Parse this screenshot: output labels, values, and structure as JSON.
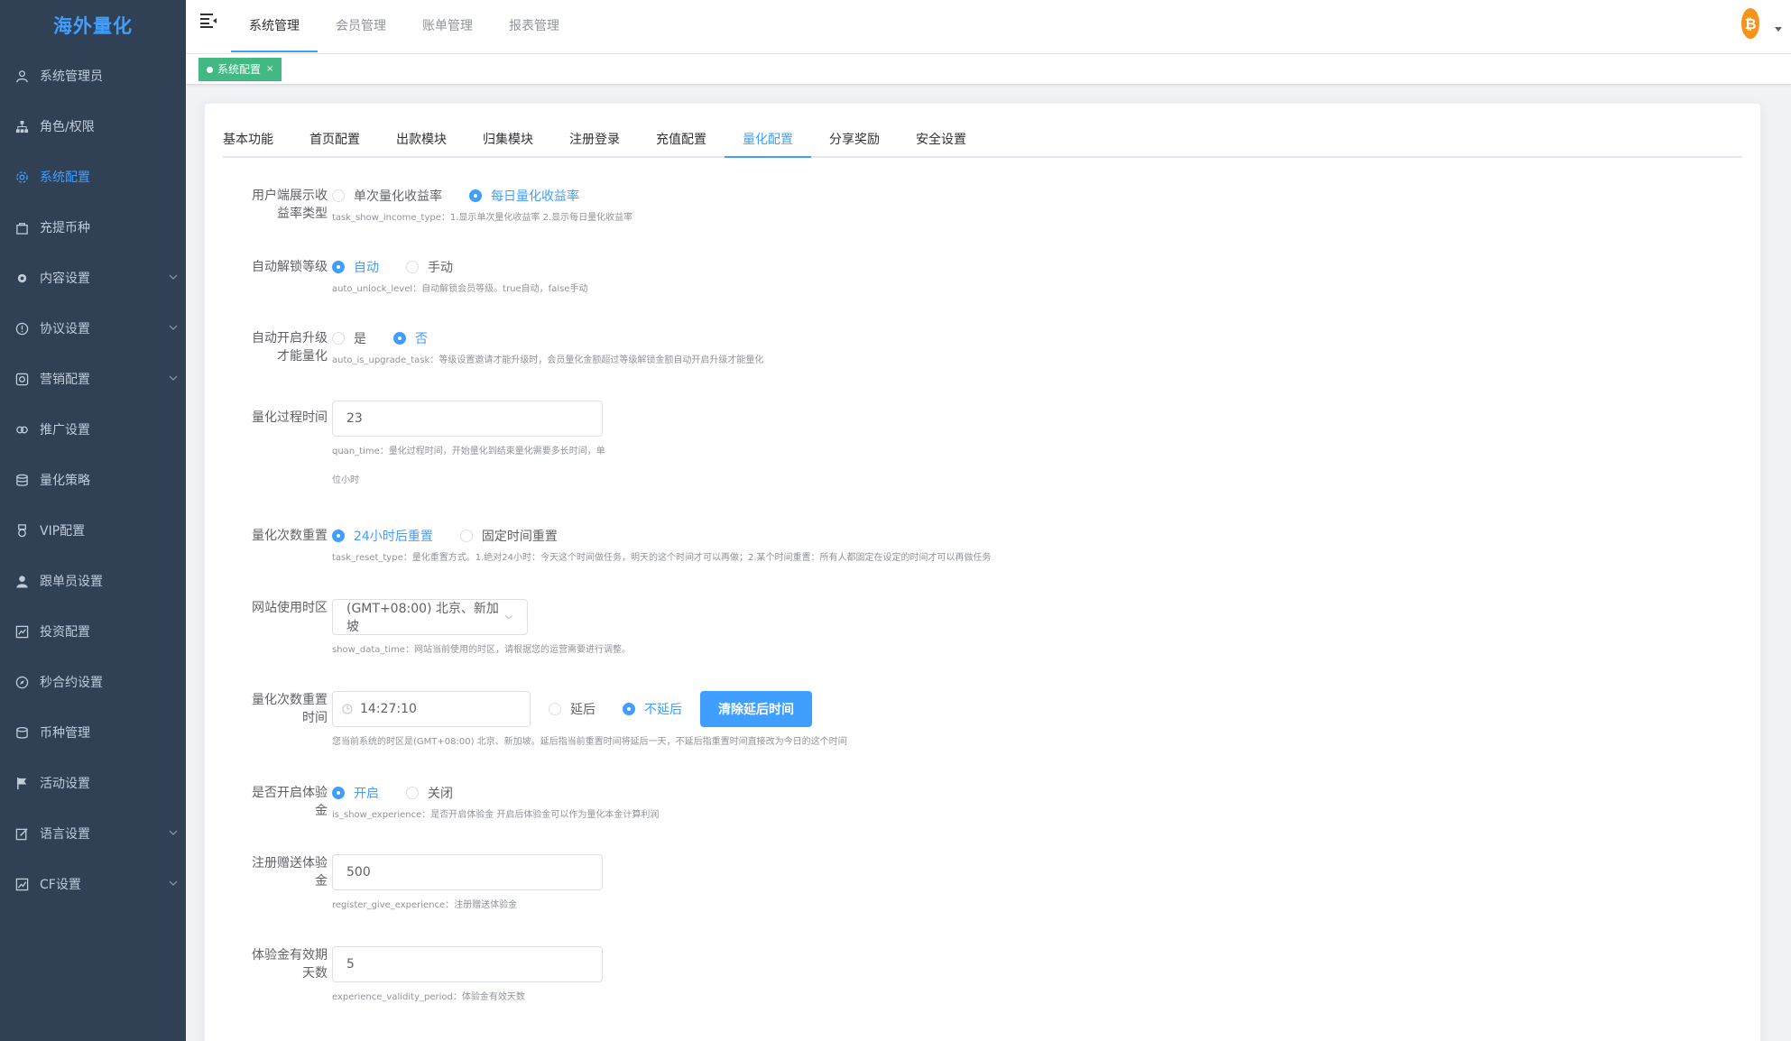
{
  "app": {
    "logo": "海外量化"
  },
  "sidebar": {
    "items": [
      {
        "label": "系统管理员",
        "icon": "user-icon",
        "active": false,
        "arrow": false
      },
      {
        "label": "角色/权限",
        "icon": "org-tree-icon",
        "active": false,
        "arrow": false
      },
      {
        "label": "系统配置",
        "icon": "gear-icon",
        "active": true,
        "arrow": false
      },
      {
        "label": "充提币种",
        "icon": "bag-icon",
        "active": false,
        "arrow": false
      },
      {
        "label": "内容设置",
        "icon": "settings-icon",
        "active": false,
        "arrow": true
      },
      {
        "label": "协议设置",
        "icon": "info-circle-icon",
        "active": false,
        "arrow": true
      },
      {
        "label": "营销配置",
        "icon": "marketing-icon",
        "active": false,
        "arrow": true
      },
      {
        "label": "推广设置",
        "icon": "link-icon",
        "active": false,
        "arrow": false
      },
      {
        "label": "量化策略",
        "icon": "database-icon",
        "active": false,
        "arrow": false
      },
      {
        "label": "VIP配置",
        "icon": "medal-icon",
        "active": false,
        "arrow": false
      },
      {
        "label": "跟单员设置",
        "icon": "person-icon",
        "active": false,
        "arrow": false
      },
      {
        "label": "投资配置",
        "icon": "invest-icon",
        "active": false,
        "arrow": false
      },
      {
        "label": "秒合约设置",
        "icon": "compass-icon",
        "active": false,
        "arrow": false
      },
      {
        "label": "币种管理",
        "icon": "coins-icon",
        "active": false,
        "arrow": false
      },
      {
        "label": "活动设置",
        "icon": "flag-icon",
        "active": false,
        "arrow": false
      },
      {
        "label": "语言设置",
        "icon": "edit-icon",
        "active": false,
        "arrow": true
      },
      {
        "label": "CF设置",
        "icon": "chart-icon",
        "active": false,
        "arrow": true
      }
    ]
  },
  "topbar": {
    "tabs": [
      {
        "label": "系统管理",
        "active": true
      },
      {
        "label": "会员管理",
        "active": false
      },
      {
        "label": "账单管理",
        "active": false
      },
      {
        "label": "报表管理",
        "active": false
      }
    ],
    "avatar_icon": "bitcoin-icon"
  },
  "tagsview": {
    "tag_label": "系统配置",
    "close": "×"
  },
  "config_tabs": [
    {
      "label": "基本功能",
      "active": false
    },
    {
      "label": "首页配置",
      "active": false
    },
    {
      "label": "出款模块",
      "active": false
    },
    {
      "label": "归集模块",
      "active": false
    },
    {
      "label": "注册登录",
      "active": false
    },
    {
      "label": "充值配置",
      "active": false
    },
    {
      "label": "量化配置",
      "active": true
    },
    {
      "label": "分享奖励",
      "active": false
    },
    {
      "label": "安全设置",
      "active": false
    }
  ],
  "form": {
    "income_type": {
      "label_l1": "用户端展示收",
      "label_l2": "益率类型",
      "opt1": "单次量化收益率",
      "opt2": "每日量化收益率",
      "hint": "task_show_income_type：1.显示单次量化收益率 2.显示每日量化收益率"
    },
    "unlock_level": {
      "label": "自动解锁等级",
      "opt1": "自动",
      "opt2": "手动",
      "hint": "auto_unlock_level：自动解锁会员等级。true自动，false手动"
    },
    "upgrade_task": {
      "label_l1": "自动开启升级",
      "label_l2": "才能量化",
      "opt1": "是",
      "opt2": "否",
      "hint": "auto_is_upgrade_task：等级设置邀请才能升级时，会员量化金额超过等级解锁金额自动开启升级才能量化"
    },
    "quan_time": {
      "label": "量化过程时间",
      "value": "23",
      "hint_l1": "quan_time：量化过程时间，开始量化到结束量化需要多长时间，单",
      "hint_l2": "位小时"
    },
    "reset_type": {
      "label": "量化次数重置",
      "opt1": "24小时后重置",
      "opt2": "固定时间重置",
      "hint": "task_reset_type：量化重置方式。1.绝对24小时：今天这个时间做任务，明天的这个时间才可以再做；2.某个时间重置：所有人都固定在设定的时间才可以再做任务"
    },
    "timezone": {
      "label": "网站使用时区",
      "value": "(GMT+08:00) 北京、新加坡",
      "hint": "show_data_time：网站当前使用的时区，请根据您的运营需要进行调整。"
    },
    "reset_time": {
      "label_l1": "量化次数重置",
      "label_l2": "时间",
      "value": "14:27:10",
      "opt1": "延后",
      "opt2": "不延后",
      "button": "清除延后时间",
      "hint": "您当前系统的时区是(GMT+08:00) 北京、新加坡。延后指当前重置时间将延后一天，不延后指重置时间直接改为今日的这个时间"
    },
    "experience": {
      "label_l1": "是否开启体验",
      "label_l2": "金",
      "opt1": "开启",
      "opt2": "关闭",
      "hint": "is_show_experience：是否开启体验金 开启后体验金可以作为量化本金计算利润"
    },
    "register_experience": {
      "label_l1": "注册赠送体验",
      "label_l2": "金",
      "value": "500",
      "hint": "register_give_experience：注册赠送体验金"
    },
    "validity_period": {
      "label_l1": "体验金有效期",
      "label_l2": "天数",
      "value": "5",
      "hint": "experience_validity_period：体验金有效天数"
    }
  },
  "colors": {
    "sidebar_bg": "#304156",
    "accent": "#409eff",
    "tag_green": "#42b983"
  }
}
